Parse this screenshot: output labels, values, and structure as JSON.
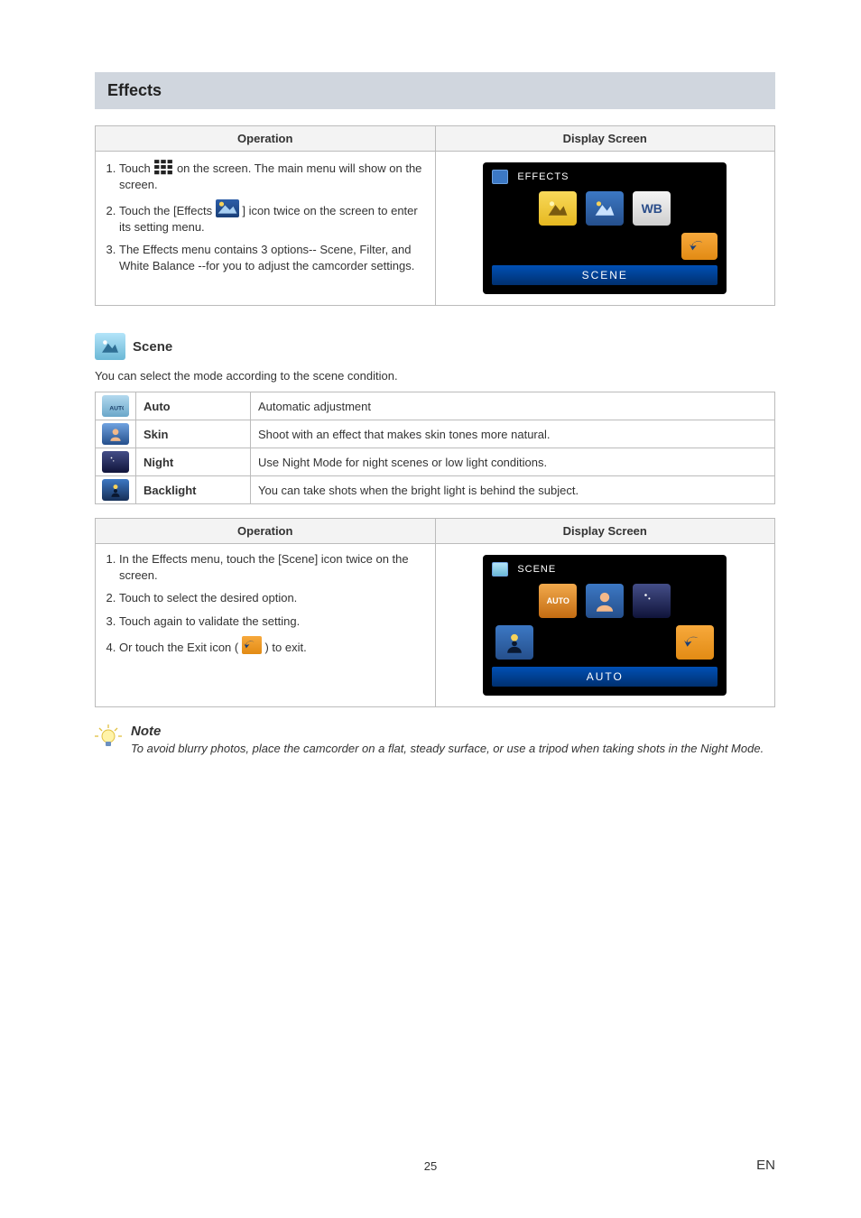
{
  "section": {
    "title": "Effects"
  },
  "headers": {
    "operation": "Operation",
    "display": "Display Screen"
  },
  "effects_ops": {
    "step1_a": "Touch ",
    "step1_b": " on the screen. The main menu will show on the screen.",
    "step2_a": "Touch the [Effects ",
    "step2_b": " ] icon twice on the screen to enter its setting menu.",
    "step3": "The Effects menu contains 3 options-- Scene, Filter, and White Balance --for you to adjust the camcorder settings."
  },
  "effects_panel": {
    "title": "EFFECTS",
    "wb": "WB",
    "footer": "SCENE"
  },
  "scene": {
    "title": "Scene",
    "desc": "You can select the mode according to the scene condition."
  },
  "modes": [
    {
      "name": "Auto",
      "desc": "Automatic adjustment"
    },
    {
      "name": "Skin",
      "desc": "Shoot with an effect that makes skin tones more natural."
    },
    {
      "name": "Night",
      "desc": "Use Night Mode for night scenes or low light conditions."
    },
    {
      "name": "Backlight",
      "desc": "You can take shots when the bright light is behind the subject."
    }
  ],
  "scene_ops": {
    "step1": "In the Effects menu, touch the [Scene] icon twice on the screen.",
    "step2": "Touch to select the desired option.",
    "step3": "Touch again to validate the setting.",
    "step4_a": "Or touch the Exit icon ( ",
    "step4_b": " ) to exit."
  },
  "scene_panel": {
    "title": "SCENE",
    "auto": "AUTO",
    "footer": "AUTO"
  },
  "note": {
    "title": "Note",
    "text": "To avoid blurry photos, place the camcorder on a flat, steady surface, or use a tripod when taking shots in the Night Mode."
  },
  "page_number": "25",
  "lang": "EN"
}
